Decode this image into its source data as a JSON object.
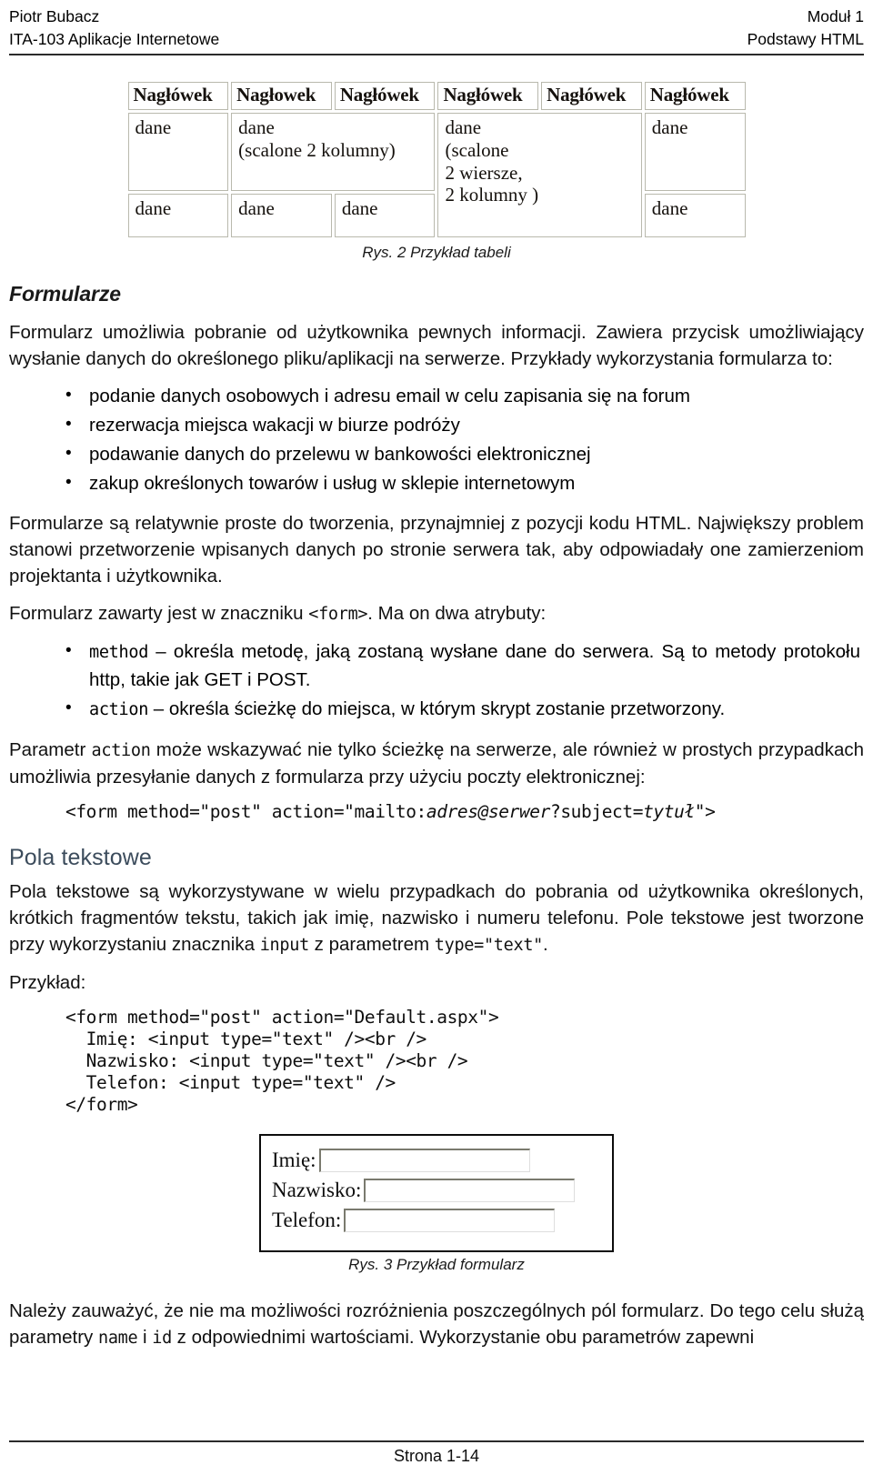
{
  "header": {
    "author": "Piotr Bubacz",
    "course": "ITA-103 Aplikacje Internetowe",
    "module": "Moduł 1",
    "topic": "Podstawy HTML"
  },
  "figure_table": {
    "caption": "Rys. 2 Przykład tabeli",
    "headers": [
      "Nagłówek",
      "Nagłowek",
      "Nagłówek",
      "Nagłówek",
      "Nagłówek",
      "Nagłówek"
    ],
    "row1": {
      "c1": "dane",
      "c2_line1": "dane",
      "c2_line2": "(scalone 2 kolumny)",
      "c3_line1": "dane",
      "c3_line2": "(scalone",
      "c3_line3": "2 wiersze,",
      "c3_line4": "2 kolumny )",
      "c4": "dane"
    },
    "row2": {
      "c1": "dane",
      "c2": "dane",
      "c3": "dane",
      "c4": "dane"
    }
  },
  "sections": {
    "formularze_heading": "Formularze",
    "intro_p1": "Formularz umożliwia pobranie od użytkownika pewnych informacji. Zawiera przycisk umożliwiający wysłanie danych do określonego pliku/aplikacji na serwerze. Przykłady wykorzystania formularza to:",
    "examples_list": [
      "podanie danych osobowych i adresu email w celu zapisania się na forum",
      "rezerwacja miejsca wakacji w biurze podróży",
      "podawanie danych do przelewu w bankowości elektronicznej",
      "zakup określonych towarów i usług w sklepie internetowym"
    ],
    "p_after_list": "Formularze są relatywnie proste do tworzenia, przynajmniej z pozycji kodu HTML. Największy problem stanowi przetworzenie wpisanych danych po stronie serwera tak, aby odpowiadały one zamierzeniom projektanta i użytkownika.",
    "p_form_tag_pre": "Formularz zawarty jest w znaczniku ",
    "p_form_tag_code": "<form>",
    "p_form_tag_post": ". Ma on dwa atrybuty:",
    "attr_list": [
      {
        "code": "method",
        "text": " – określa metodę, jaką zostaną wysłane dane do serwera. Są to metody protokołu http, takie jak GET i POST."
      },
      {
        "code": "action",
        "text": " – określa ścieżkę do miejsca, w którym skrypt zostanie przetworzony."
      }
    ],
    "p_param_pre": "Parametr ",
    "p_param_code": "action",
    "p_param_post": " może wskazywać nie tylko ścieżkę na serwerze, ale również w prostych przypadkach umożliwia przesyłanie danych z formularza przy użyciu poczty elektronicznej:",
    "mailto_code_a": "<form method=\"post\" action=\"mailto:",
    "mailto_code_italic1": "adres@serwer",
    "mailto_code_b": "?subject=",
    "mailto_code_italic2": "tytuł",
    "mailto_code_c": "\">",
    "pola_heading": "Pola tekstowe",
    "pola_p_a": "Pola tekstowe są wykorzystywane w wielu przypadkach do pobrania od użytkownika określonych, krótkich fragmentów tekstu, takich jak imię, nazwisko i numeru telefonu. Pole tekstowe jest tworzone przy wykorzystaniu znacznika ",
    "pola_p_code1": "input",
    "pola_p_b": " z parametrem ",
    "pola_p_code2": "type=\"text\"",
    "pola_p_c": ".",
    "przyklad_label": "Przykład:",
    "example_code_lines": [
      "<form method=\"post\" action=\"Default.aspx\">",
      "  Imię: <input type=\"text\" /><br />",
      "  Nazwisko: <input type=\"text\" /><br />",
      "  Telefon: <input type=\"text\" />",
      "</form>"
    ],
    "final_p_a": "Należy zauważyć, że nie ma możliwości rozróżnienia poszczególnych pól formularz. Do tego celu służą parametry ",
    "final_p_code1": "name",
    "final_p_b": " i ",
    "final_p_code2": "id",
    "final_p_c": " z odpowiednimi wartościami. Wykorzystanie obu parametrów zapewni"
  },
  "figure_form": {
    "caption": "Rys. 3 Przykład formularz",
    "fields": [
      {
        "label": "Imię:",
        "value": ""
      },
      {
        "label": "Nazwisko:",
        "value": ""
      },
      {
        "label": "Telefon:",
        "value": ""
      }
    ]
  },
  "footer": {
    "page_label": "Strona 1-14"
  }
}
